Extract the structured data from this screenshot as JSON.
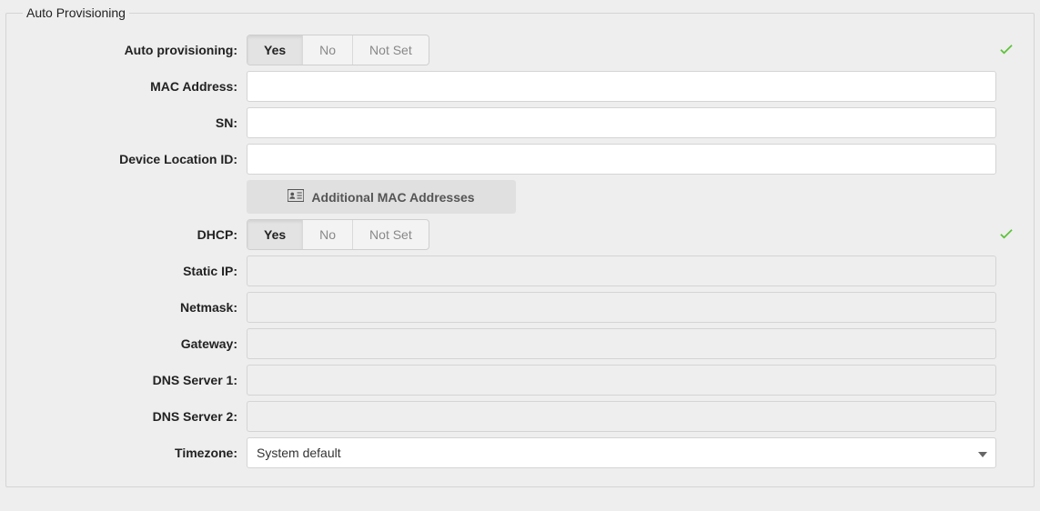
{
  "legend": "Auto Provisioning",
  "labels": {
    "autoProvisioning": "Auto provisioning:",
    "mac": "MAC Address:",
    "sn": "SN:",
    "deviceLocationId": "Device Location ID:",
    "dhcp": "DHCP:",
    "staticIp": "Static IP:",
    "netmask": "Netmask:",
    "gateway": "Gateway:",
    "dns1": "DNS Server 1:",
    "dns2": "DNS Server 2:",
    "timezone": "Timezone:"
  },
  "toggleOptions": {
    "yes": "Yes",
    "no": "No",
    "notSet": "Not Set"
  },
  "additionalMacButton": "Additional MAC Addresses",
  "values": {
    "mac": "",
    "sn": "",
    "deviceLocationId": "",
    "staticIp": "",
    "netmask": "",
    "gateway": "",
    "dns1": "",
    "dns2": "",
    "timezone": "System default"
  },
  "autoProvisioningSelected": "yes",
  "dhcpSelected": "yes"
}
